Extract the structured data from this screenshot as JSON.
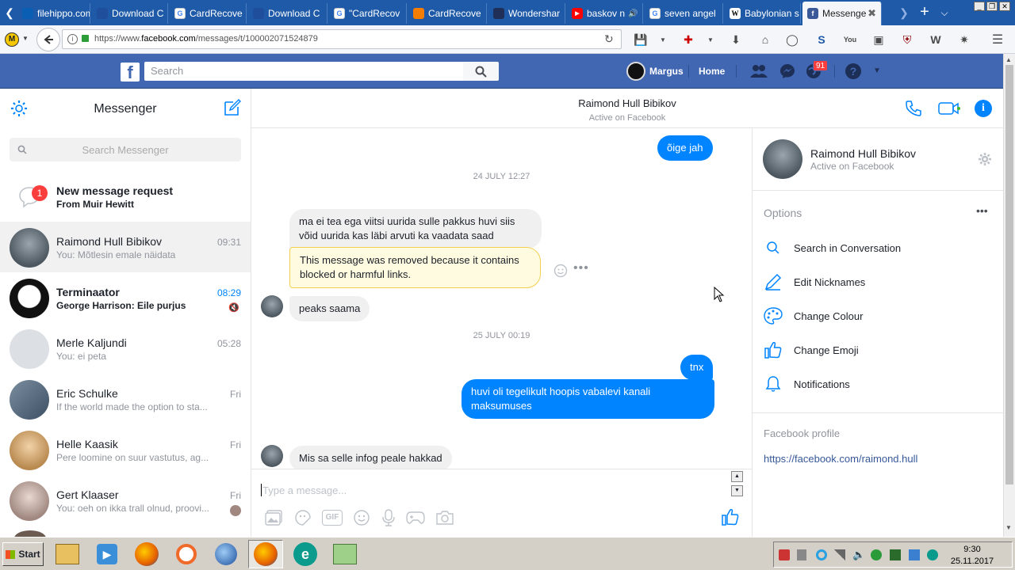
{
  "browser": {
    "tabs": [
      {
        "title": "filehippo.com",
        "icon": "filehippo-icon",
        "color": "#0a5fb4"
      },
      {
        "title": "Download C",
        "icon": "download-icon",
        "color": "#1f4f9c"
      },
      {
        "title": "CardRecove",
        "icon": "google-icon",
        "color": "#ffffff"
      },
      {
        "title": "Download C",
        "icon": "download-icon",
        "color": "#1f4f9c"
      },
      {
        "title": "\"CardRecov",
        "icon": "google-icon",
        "color": "#ffffff"
      },
      {
        "title": "CardRecove",
        "icon": "blogger-icon",
        "color": "#f57d00"
      },
      {
        "title": "Wondershar",
        "icon": "wondershare-icon",
        "color": "#1f2f57"
      },
      {
        "title": "baskov n",
        "icon": "youtube-icon",
        "color": "#ff0000"
      },
      {
        "title": "seven angel",
        "icon": "google-icon",
        "color": "#ffffff"
      },
      {
        "title": "Babylonian s",
        "icon": "wikipedia-icon",
        "color": "#ffffff"
      },
      {
        "title": "Messenge",
        "icon": "facebook-icon",
        "color": "#3b5998"
      }
    ],
    "url": "https://www.facebook.com/messages/t/100002071524879",
    "url_domain": "facebook.com"
  },
  "facebook": {
    "search_placeholder": "Search",
    "user_name": "Margus",
    "home_label": "Home",
    "notification_count": "91",
    "brand_color": "#4267b2"
  },
  "sidebar": {
    "title": "Messenger",
    "search_placeholder": "Search Messenger",
    "request": {
      "title": "New message request",
      "from": "From Muir Hewitt",
      "count": "1"
    },
    "conversations": [
      {
        "name": "Raimond Hull Bibikov",
        "snippet": "You: Mõtlesin emale näidata",
        "time": "09:31",
        "unread": false,
        "selected": true
      },
      {
        "name": "Terminaator",
        "snippet": "George Harrison: Eile purjus",
        "time": "08:29",
        "unread": true,
        "selected": false
      },
      {
        "name": "Merle Kaljundi",
        "snippet": "You: ei peta",
        "time": "05:28",
        "unread": false,
        "selected": false
      },
      {
        "name": "Eric Schulke",
        "snippet": "If the world made the option to sta...",
        "time": "Fri",
        "unread": false,
        "selected": false
      },
      {
        "name": "Helle Kaasik",
        "snippet": "Pere loomine on suur vastutus, ag...",
        "time": "Fri",
        "unread": false,
        "selected": false
      },
      {
        "name": "Gert Klaaser",
        "snippet": "You: oeh on ikka trall olnud, proovi...",
        "time": "Fri",
        "unread": false,
        "selected": false
      }
    ]
  },
  "chat": {
    "contact_name": "Raimond Hull Bibikov",
    "status": "Active on Facebook",
    "date_1": "24 JULY 12:27",
    "date_2": "25 JULY 00:19",
    "messages": {
      "m0": "õige jah",
      "m1": "ma ei tea ega viitsi uurida sulle pakkus huvi siis võid uurida kas läbi arvuti ka vaadata saad",
      "m2": "This message was removed because it contains blocked or harmful links.",
      "m3": "peaks saama",
      "m4": "tnx",
      "m5": "huvi oli tegelikult hoopis vabalevi kanali maksumuses",
      "m6": "Mis sa selle infog peale hakkad"
    },
    "composer_placeholder": "Type a message...",
    "accent_color": "#0084ff"
  },
  "info_panel": {
    "name": "Raimond Hull Bibikov",
    "status": "Active on Facebook",
    "options_title": "Options",
    "options": [
      {
        "label": "Search in Conversation",
        "icon": "search-icon"
      },
      {
        "label": "Edit Nicknames",
        "icon": "pencil-icon"
      },
      {
        "label": "Change Colour",
        "icon": "palette-icon"
      },
      {
        "label": "Change Emoji",
        "icon": "thumbs-up-icon"
      },
      {
        "label": "Notifications",
        "icon": "bell-icon"
      }
    ],
    "profile_title": "Facebook profile",
    "profile_link": "https://facebook.com/raimond.hull"
  },
  "taskbar": {
    "start_label": "Start",
    "clock_time": "9:30",
    "clock_date": "25.11.2017"
  }
}
